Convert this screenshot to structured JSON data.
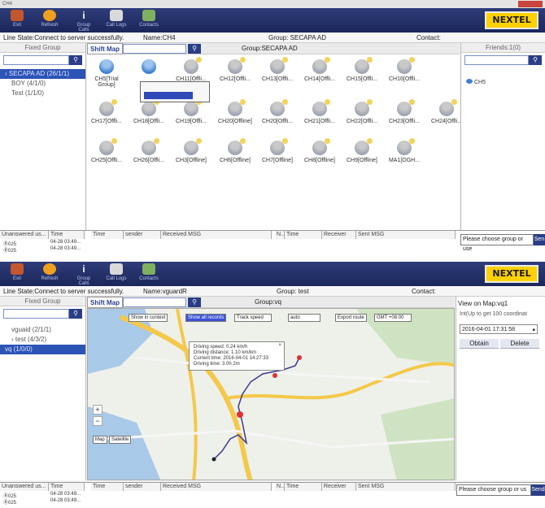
{
  "screen1": {
    "window_title": "CH4",
    "toolbar": [
      {
        "label": "Exit",
        "icon": "exit-icon"
      },
      {
        "label": "Refresh",
        "icon": "refresh-icon"
      },
      {
        "label": "Group Calls",
        "icon": "info-icon"
      },
      {
        "label": "Call Logs",
        "icon": "call-logs-icon"
      },
      {
        "label": "Contacts",
        "icon": "contacts-icon"
      }
    ],
    "logo": "NEXTEL",
    "status": {
      "line_state": "Line State:Connect to server successfully.",
      "name": "Name:CH4",
      "group": "Group: SECAPA AD",
      "contact": "Contact:"
    },
    "fixed_group_title": "Fixed Group",
    "groups": [
      {
        "label": "SECAPA AD (26/1/1)",
        "selected": true
      },
      {
        "label": "BOY (4/1/0)",
        "selected": false
      },
      {
        "label": "Test (1/1/0)",
        "selected": false
      }
    ],
    "shift_map_label": "Shift Map",
    "center_title": "Group:SECAPA AD",
    "members": [
      "CH5[Trial Group]",
      "",
      "CH11[Offli...",
      "CH12[Offli...",
      "CH13[Offli...",
      "CH14[Offli...",
      "CH15[Offli...",
      "CH16[Offli...",
      "CH17[Offli...",
      "CH18[Offli...",
      "CH19[Offli...",
      "CH20[Offline]",
      "CH20[Offli...",
      "CH21[Offli...",
      "CH22[Offli...",
      "CH23[Offli...",
      "CH24[Offli...",
      "CH25[Offli...",
      "CH26[Offli...",
      "CH3[Offline]",
      "CH6[Offline]",
      "CH7[Offline]",
      "CH8[Offline]",
      "CH9[Offline]",
      "MA1[OGH..."
    ],
    "friends_title": "Friends:1(0)",
    "friends": [
      "CH5"
    ],
    "msg_headers_left": [
      "Unanswered us...",
      "Time"
    ],
    "msg_rows_left": [
      [
        "Ⓡ025",
        "04-28 03:49..."
      ],
      [
        "Ⓡ025",
        "04-28 03:49..."
      ]
    ],
    "msg_headers_mid": [
      "Time",
      "sender",
      "Received MSG"
    ],
    "msg_headers_right": [
      "N..",
      "Time",
      "Receiver",
      "Sent MSG"
    ],
    "msg_placeholder": "Please choose group or use",
    "send_label": "Sen"
  },
  "screen2": {
    "toolbar": [
      {
        "label": "Exit",
        "icon": "exit-icon"
      },
      {
        "label": "Refresh",
        "icon": "refresh-icon"
      },
      {
        "label": "Group Calls",
        "icon": "info-icon"
      },
      {
        "label": "Call Logs",
        "icon": "call-logs-icon"
      },
      {
        "label": "Contacts",
        "icon": "contacts-icon"
      }
    ],
    "logo": "NEXTEL",
    "status": {
      "line_state": "Line State:Connect to server successfully.",
      "name": "Name:vguardR",
      "group": "Group: test",
      "contact": "Contact:"
    },
    "fixed_group_title": "Fixed Group",
    "groups": [
      {
        "label": "vguaid (2/1/1)",
        "selected": false
      },
      {
        "label": "test (4/3/2)",
        "selected": false
      },
      {
        "label": "vq (1/0/0)",
        "selected": true
      }
    ],
    "shift_map_label": "Shift Map",
    "center_title": "Group:vq",
    "map_controls": [
      "Show in context",
      "Show all records",
      "Track speed",
      "auto",
      "Export route",
      "GMT +08:00"
    ],
    "popup": [
      "Driving speed: 0.24 km/h",
      "Driving distance: 1.10 km/km",
      "Current time: 2016-04-01 14:27:33",
      "Driving time: 3.0h 2m"
    ],
    "map_labels": [
      "Map",
      "Satellite"
    ],
    "right_title": "View on Map:vq1",
    "right_hint": "Int(Up to get 100 coordinat",
    "datetime_value": "2016-04-01 17:31:58",
    "obtain_label": "Obtain",
    "delete_label": "Delete",
    "msg_headers_left": [
      "Unanswered us...",
      "Time"
    ],
    "msg_rows_left": [
      [
        "Ⓡ025",
        "04-28 03:49..."
      ],
      [
        "Ⓡ025",
        "04-28 03:49..."
      ]
    ],
    "msg_headers_mid": [
      "Time",
      "sender",
      "Received MSG"
    ],
    "msg_headers_right": [
      "N..",
      "Time",
      "Receiver",
      "Sent MSG"
    ],
    "msg_placeholder": "Please choose group or us",
    "send_label": "Send"
  },
  "colors": {
    "toolbar": "#1b275a",
    "accent": "#2a3d86",
    "logo": "#ffd100",
    "route": "#3b3b8f"
  }
}
